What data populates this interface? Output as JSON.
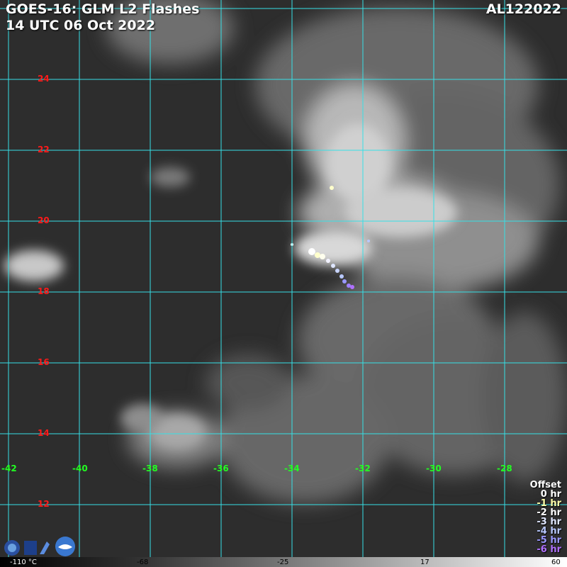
{
  "title": {
    "line1": "GOES-16: GLM L2 Flashes",
    "line2": "14 UTC 06 Oct 2022",
    "storm_id": "AL122022"
  },
  "latitudes": [
    "24",
    "22",
    "20",
    "18",
    "16",
    "14",
    "12"
  ],
  "longitudes": [
    "-42",
    "-40",
    "-38",
    "-36",
    "-34",
    "-32",
    "-30",
    "-28"
  ],
  "legend": {
    "heading": "Offset",
    "entries": [
      {
        "label": "0 hr",
        "color": "#ffffff"
      },
      {
        "label": "-1 hr",
        "color": "#ffffaa"
      },
      {
        "label": "-2 hr",
        "color": "#ffffff"
      },
      {
        "label": "-3 hr",
        "color": "#dfe6ff"
      },
      {
        "label": "-4 hr",
        "color": "#b8c8ff"
      },
      {
        "label": "-5 hr",
        "color": "#9a98ff"
      },
      {
        "label": "-6 hr",
        "color": "#b070ff"
      }
    ]
  },
  "colorbar": {
    "labels": [
      "-110 °C",
      "-68",
      "-25",
      "17",
      "60"
    ]
  },
  "colors": {
    "grid": "#36e0e6",
    "lat_label": "#ff1a1a",
    "lon_label": "#22ff22"
  }
}
